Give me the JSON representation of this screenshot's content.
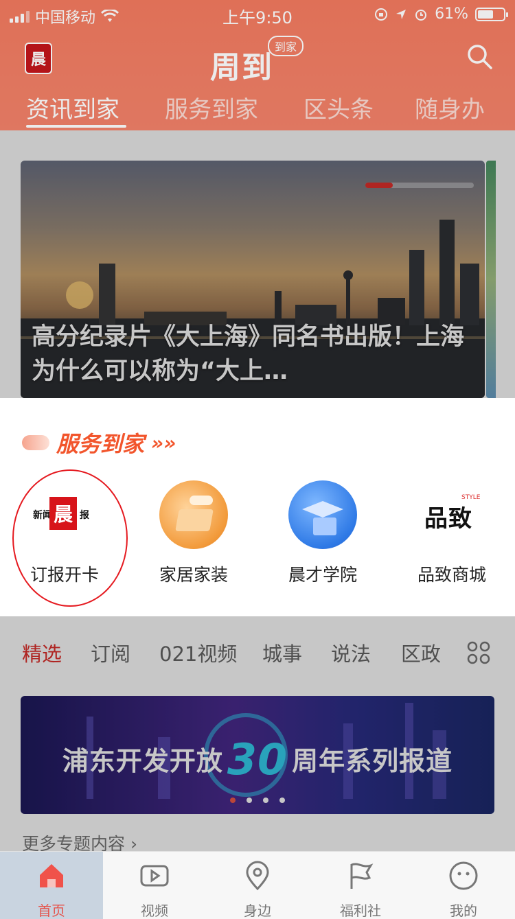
{
  "status_bar": {
    "carrier": "中国移动",
    "time": "上午9:50",
    "battery": "61%",
    "battery_level": 0.61
  },
  "header": {
    "logo_char": "晨",
    "brand_name": "周到",
    "brand_tag": "到家",
    "tabs": [
      {
        "label": "资讯到家",
        "active": true
      },
      {
        "label": "服务到家",
        "active": false
      },
      {
        "label": "区头条",
        "active": false
      },
      {
        "label": "随身办",
        "active": false
      }
    ]
  },
  "hero": {
    "title": "高分纪录片《大上海》同名书出版！上海为什么可以称为“大上…",
    "progress": 0.25
  },
  "services": {
    "title": "服务到家",
    "arrow": "»»",
    "items": [
      {
        "label": "订报开卡",
        "icon": "newspaper-logo-icon",
        "brand_char": "晨",
        "brand_left": "新闻",
        "brand_right": "报"
      },
      {
        "label": "家居家装",
        "icon": "home-decor-icon"
      },
      {
        "label": "晨才学院",
        "icon": "academy-icon"
      },
      {
        "label": "品致商城",
        "icon": "pinzhi-store-icon",
        "brand_text": "品致",
        "brand_small": "STYLE"
      }
    ]
  },
  "categories": [
    {
      "label": "精选",
      "active": true
    },
    {
      "label": "订阅",
      "active": false
    },
    {
      "label": "021视频",
      "active": false
    },
    {
      "label": "城事",
      "active": false
    },
    {
      "label": "说法",
      "active": false
    },
    {
      "label": "区政",
      "active": false
    }
  ],
  "banner": {
    "text_left": "浦东开发开放",
    "number": "30",
    "text_right": "周年系列报道",
    "dots": 4,
    "active_dot": 0
  },
  "more_topics": "更多专题内容 ›",
  "tab_bar": [
    {
      "label": "首页",
      "icon": "home-icon",
      "active": true
    },
    {
      "label": "视频",
      "icon": "video-icon",
      "active": false
    },
    {
      "label": "身边",
      "icon": "location-pin-icon",
      "active": false
    },
    {
      "label": "福利社",
      "icon": "flag-icon",
      "active": false
    },
    {
      "label": "我的",
      "icon": "profile-face-icon",
      "active": false
    }
  ],
  "colors": {
    "header": "#f27a5f",
    "accent": "#e0302c",
    "service_title": "#f2552c",
    "annotation_circle": "#e5191f"
  }
}
